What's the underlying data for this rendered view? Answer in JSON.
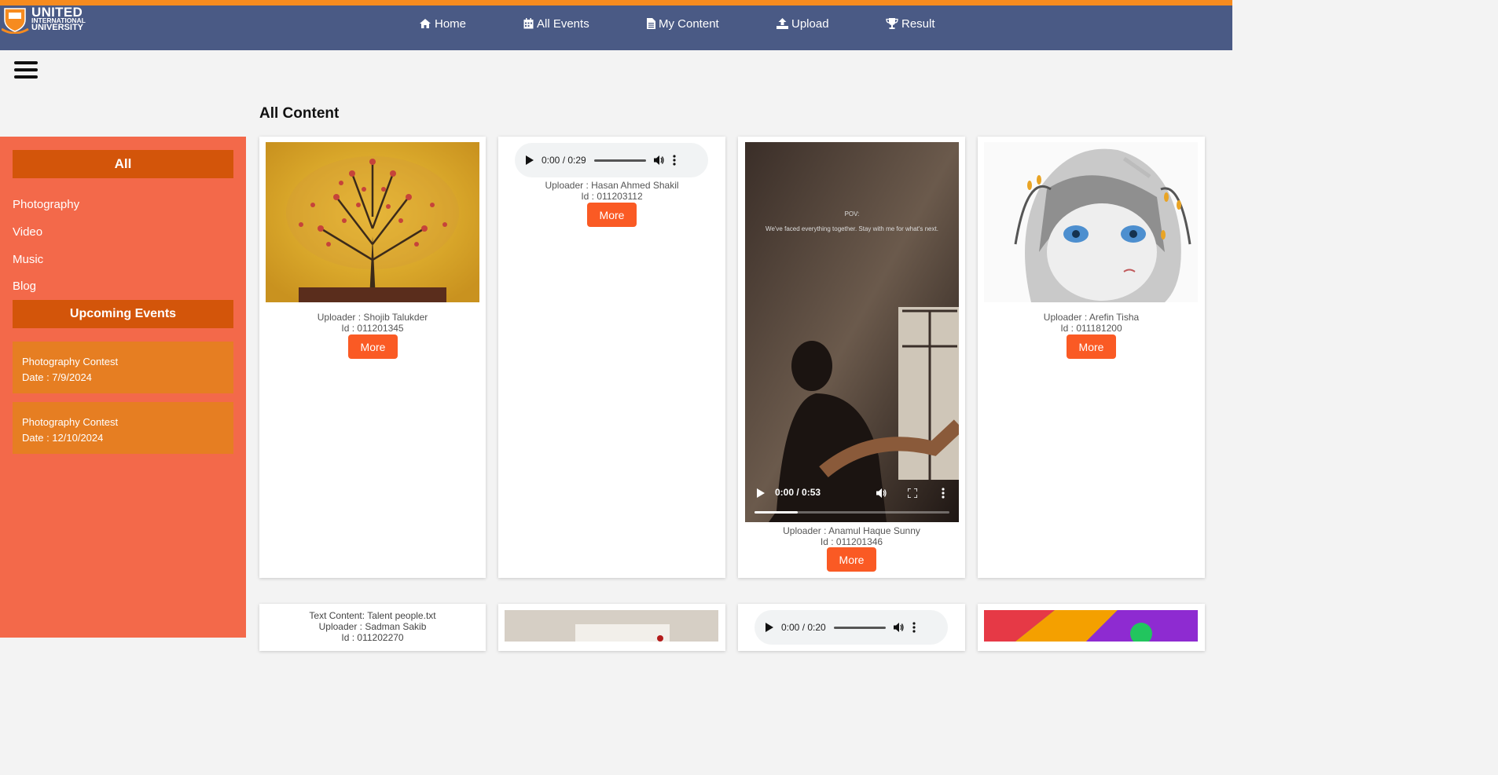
{
  "header": {
    "logo": {
      "line1": "UNITED",
      "line2": "INTERNATIONAL",
      "line3": "UNIVERSITY"
    },
    "nav": [
      {
        "label": "Home",
        "icon": "home-icon"
      },
      {
        "label": "All Events",
        "icon": "calendar-icon"
      },
      {
        "label": "My Content",
        "icon": "document-icon"
      },
      {
        "label": "Upload",
        "icon": "upload-icon"
      },
      {
        "label": "Result",
        "icon": "trophy-icon"
      }
    ],
    "colors": {
      "top_strip": "#f68b1f",
      "navbar": "#4a5a85"
    }
  },
  "main": {
    "title": "All Content"
  },
  "sidebar": {
    "all_label": "All",
    "categories": [
      "Photography",
      "Video",
      "Music",
      "Blog"
    ],
    "upcoming_label": "Upcoming Events",
    "events": [
      {
        "name": "Photography Contest",
        "date": "Date : 7/9/2024"
      },
      {
        "name": "Photography Contest",
        "date": "Date : 12/10/2024"
      }
    ],
    "colors": {
      "background": "#f3694a",
      "header_block": "#d3550a",
      "event_card": "#e67e22"
    }
  },
  "cards": [
    {
      "type": "image",
      "uploader": "Uploader : Shojib Talukder",
      "id": "Id : 011201345",
      "button": "More"
    },
    {
      "type": "audio",
      "audio_time": "0:00 / 0:29",
      "uploader": "Uploader : Hasan Ahmed Shakil",
      "id": "Id : 011203112",
      "button": "More"
    },
    {
      "type": "video",
      "video_time": "0:00 / 0:53",
      "overlay_line1": "POV:",
      "overlay_line2": "We've faced everything together. Stay with me for what's next.",
      "uploader": "Uploader : Anamul Haque Sunny",
      "id": "Id : 011201346",
      "button": "More"
    },
    {
      "type": "image",
      "uploader": "Uploader : Arefin Tisha",
      "id": "Id : 011181200",
      "button": "More"
    }
  ],
  "cards_row2": [
    {
      "type": "text",
      "text_title": "Text Content: Talent people.txt",
      "uploader": "Uploader : Sadman Sakib",
      "id": "Id : 011202270"
    },
    {
      "type": "image"
    },
    {
      "type": "audio",
      "audio_time": "0:00 / 0:20"
    },
    {
      "type": "image"
    }
  ],
  "colors": {
    "more_button": "#fa5a24"
  }
}
